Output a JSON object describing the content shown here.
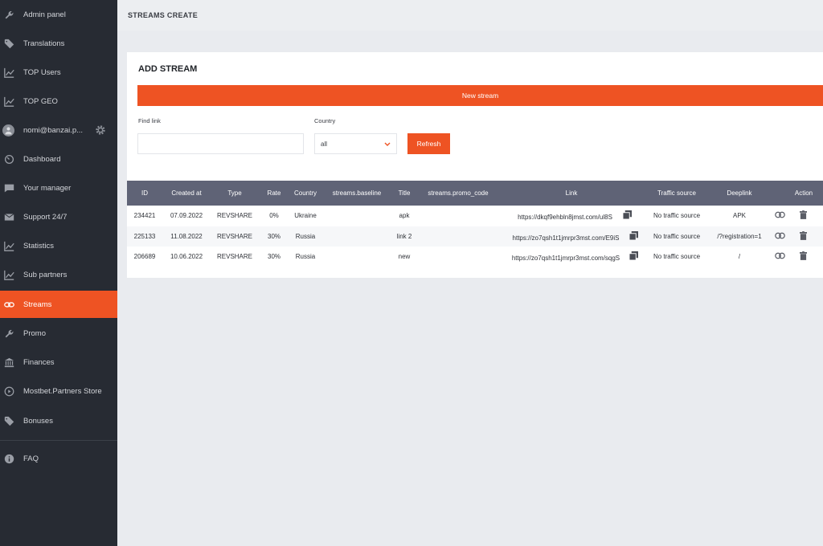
{
  "sidebar": {
    "items": [
      {
        "label": "Admin panel",
        "icon": "wrench-icon"
      },
      {
        "label": "Translations",
        "icon": "tag-icon"
      },
      {
        "label": "TOP Users",
        "icon": "chart-line-icon"
      },
      {
        "label": "TOP GEO",
        "icon": "chart-line-icon"
      },
      {
        "label": "nomi@banzai.p...",
        "icon": "avatar"
      },
      {
        "label": "Dashboard",
        "icon": "gauge-icon"
      },
      {
        "label": "Your manager",
        "icon": "chat-icon"
      },
      {
        "label": "Support 24/7",
        "icon": "mail-icon"
      },
      {
        "label": "Statistics",
        "icon": "chart-line-icon"
      },
      {
        "label": "Sub partners",
        "icon": "chart-line-icon"
      },
      {
        "label": "Streams",
        "icon": "link-icon"
      },
      {
        "label": "Promo",
        "icon": "wrench-icon"
      },
      {
        "label": "Finances",
        "icon": "bank-icon"
      },
      {
        "label": "Mostbet.Partners Store",
        "icon": "play-circle-icon"
      },
      {
        "label": "Bonuses",
        "icon": "tag-icon"
      },
      {
        "label": "FAQ",
        "icon": "info-icon"
      }
    ],
    "active": "Streams"
  },
  "header": {
    "title": "STREAMS CREATE"
  },
  "card": {
    "title": "ADD STREAM",
    "new_stream_label": "New stream",
    "find_link_label": "Find link",
    "find_link_value": "",
    "country_label": "Country",
    "country_value": "all",
    "refresh_label": "Refresh"
  },
  "table": {
    "headers": [
      "ID",
      "Created at",
      "Type",
      "Rate",
      "Country",
      "streams.baseline",
      "Title",
      "streams.promo_code",
      "Link",
      "Traffic source",
      "Deeplink",
      "Action"
    ],
    "rows": [
      {
        "id": "234421",
        "created": "07.09.2022",
        "type": "REVSHARE",
        "rate": "0%",
        "country": "Ukraine",
        "baseline": "",
        "title": "apk",
        "promo": "",
        "link": "https://dkqf9ehbln8jmst.com/ul8S",
        "traffic": "No traffic source",
        "deeplink": "APK"
      },
      {
        "id": "225133",
        "created": "11.08.2022",
        "type": "REVSHARE",
        "rate": "30%",
        "country": "Russia",
        "baseline": "",
        "title": "link 2",
        "promo": "",
        "link": "https://zo7qsh1t1jmrpr3mst.com/E9iS",
        "traffic": "No traffic source",
        "deeplink": "/?registration=1"
      },
      {
        "id": "206689",
        "created": "10.06.2022",
        "type": "REVSHARE",
        "rate": "30%",
        "country": "Russia",
        "baseline": "",
        "title": "new",
        "promo": "",
        "link": "https://zo7qsh1t1jmrpr3mst.com/sqgS",
        "traffic": "No traffic source",
        "deeplink": "/"
      }
    ]
  },
  "colors": {
    "accent": "#ee5323",
    "sidebar": "#272b33",
    "table_header": "#5f6376"
  }
}
